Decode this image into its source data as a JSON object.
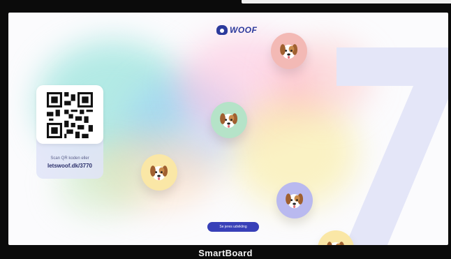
{
  "app": {
    "logo_text": "WOOF",
    "countdown_number": "7"
  },
  "qr": {
    "hint": "Scan QR koden eller",
    "url": "letswoof.dk/3770"
  },
  "dogs": [
    {
      "name": "dog-pink",
      "color": "#f3b9b5"
    },
    {
      "name": "dog-green",
      "color": "#b5e3c8"
    },
    {
      "name": "dog-yellow",
      "color": "#fae7a6"
    },
    {
      "name": "dog-purple",
      "color": "#b9b9ef"
    },
    {
      "name": "dog-yellow-partial",
      "color": "#fae7a6"
    }
  ],
  "cta": {
    "label": "Se jeres udvikling"
  },
  "caption": "SmartBoard",
  "colors": {
    "accent": "#2c3a9c",
    "cta": "#3840b8",
    "background": "#0b0b0b"
  }
}
